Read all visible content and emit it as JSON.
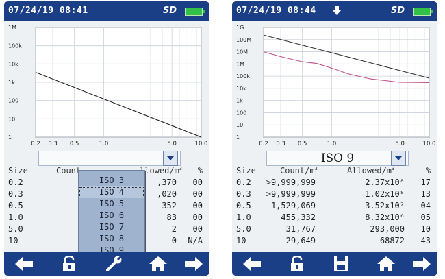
{
  "left": {
    "status": {
      "time": "07/24/19 08:41",
      "sd_label": "SD"
    },
    "chart_data": {
      "type": "line",
      "x_scale": "log",
      "y_scale": "log",
      "xlim": [
        0.2,
        10.0
      ],
      "ylim": [
        1,
        1000000
      ],
      "x_ticks": [
        "0.2",
        "0.3",
        "0.5",
        "1.0",
        "5.0",
        "10.0"
      ],
      "y_ticks": [
        "1",
        "10",
        "100",
        "1k",
        "10k",
        "100k",
        "1M"
      ],
      "grid": true,
      "series": [
        {
          "color": "#222222",
          "x": [
            0.2,
            10.0
          ],
          "y": [
            3500,
            1
          ]
        }
      ]
    },
    "table": {
      "headers": {
        "size": "Size",
        "count": "Count",
        "allowed": "llowed/m",
        "allowed_sup": "3",
        "pct": "%"
      },
      "rows": [
        {
          "size": "0.2",
          "count": "",
          "allowed": ",370",
          "pct": "00"
        },
        {
          "size": "0.3",
          "count": "",
          "allowed": ",020",
          "pct": "00"
        },
        {
          "size": "0.5",
          "count": "",
          "allowed": "352",
          "pct": "00"
        },
        {
          "size": "1.0",
          "count": "",
          "allowed": "83",
          "pct": "00"
        },
        {
          "size": "5.0",
          "count": "",
          "allowed": "2",
          "pct": "00"
        },
        {
          "size": "10",
          "count": "-",
          "allowed": "0",
          "pct": "N/A"
        }
      ]
    },
    "dropdown": {
      "items": [
        "ISO 3",
        "ISO 4",
        "ISO 5",
        "ISO 6",
        "ISO 7",
        "ISO 8",
        "ISO 9"
      ],
      "selected_index": 1
    },
    "toolbar": [
      "left-arrow-icon",
      "unlock-icon",
      "wrench-icon",
      "home-icon",
      "right-arrow-icon"
    ]
  },
  "right": {
    "status": {
      "time": "07/24/19 08:44",
      "sd_label": "SD"
    },
    "chart_data": {
      "type": "line",
      "x_scale": "log",
      "y_scale": "log",
      "xlim": [
        0.2,
        10.0
      ],
      "ylim": [
        1,
        1000000000
      ],
      "x_ticks": [
        "0.2",
        "0.3",
        "0.5",
        "1.0",
        "5.0",
        "10.0"
      ],
      "y_ticks": [
        "1",
        "10",
        "100",
        "1k",
        "10k",
        "100k",
        "1M",
        "10M",
        "100M",
        "1G"
      ],
      "grid": true,
      "series": [
        {
          "color": "#333333",
          "x": [
            0.2,
            10.0
          ],
          "y": [
            237000000,
            68872
          ]
        },
        {
          "color": "#c0508a",
          "x": [
            0.2,
            0.3,
            0.5,
            0.7,
            1.0,
            1.5,
            2.5,
            5.0,
            10.0
          ],
          "y": [
            10000000,
            4000000,
            1529069,
            1100000,
            455332,
            150000,
            60000,
            31767,
            29649
          ]
        }
      ]
    },
    "selected_class": "ISO 9",
    "table": {
      "headers": {
        "size": "Size",
        "count": "Count/m",
        "count_sup": "3",
        "allowed": "Allowed/m",
        "allowed_sup": "3",
        "pct": "%"
      },
      "rows": [
        {
          "size": "0.2",
          "count": ">9,999,999",
          "allowed": "2.37x10⁸",
          "pct": "17"
        },
        {
          "size": "0.3",
          "count": ">9,999,999",
          "allowed": "1.02x10⁸",
          "pct": "13"
        },
        {
          "size": "0.5",
          "count": "1,529,069",
          "allowed": "3.52x10⁷",
          "pct": "04"
        },
        {
          "size": "1.0",
          "count": "455,332",
          "allowed": "8.32x10⁶",
          "pct": "05"
        },
        {
          "size": "5.0",
          "count": "31,767",
          "allowed": "293,000",
          "pct": "10"
        },
        {
          "size": "10",
          "count": "29,649",
          "allowed": "68872",
          "pct": "43"
        }
      ]
    },
    "toolbar": [
      "left-arrow-icon",
      "unlock-icon",
      "save-icon",
      "home-icon",
      "right-arrow-icon"
    ]
  }
}
